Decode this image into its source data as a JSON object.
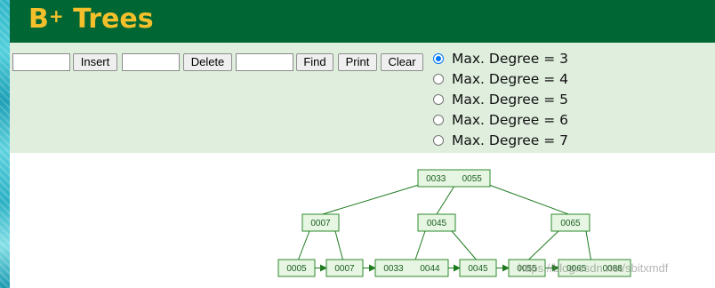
{
  "header": {
    "title_prefix": "B",
    "title_sup": "+",
    "title_rest": " Trees"
  },
  "controls": {
    "insert_value": "",
    "insert_label": "Insert",
    "delete_value": "",
    "delete_label": "Delete",
    "find_value": "",
    "find_label": "Find",
    "print_label": "Print",
    "clear_label": "Clear"
  },
  "degree_options": [
    {
      "label": "Max. Degree = 3",
      "checked": true
    },
    {
      "label": "Max. Degree = 4",
      "checked": false
    },
    {
      "label": "Max. Degree = 5",
      "checked": false
    },
    {
      "label": "Max. Degree = 6",
      "checked": false
    },
    {
      "label": "Max. Degree = 7",
      "checked": false
    }
  ],
  "tree": {
    "root": [
      "0033",
      "0055"
    ],
    "internal": [
      [
        "0007"
      ],
      [
        "0045"
      ],
      [
        "0065"
      ]
    ],
    "leaves": [
      [
        "0005"
      ],
      [
        "0007"
      ],
      [
        "0033",
        "0044"
      ],
      [
        "0045"
      ],
      [
        "0055"
      ],
      [
        "0065",
        "0088"
      ]
    ]
  },
  "watermark": "https://blog.csdn.net/sbitxmdf",
  "colors": {
    "header_bg": "#006633",
    "title": "#f3c02c",
    "panel_bg": "#dfeedd",
    "node_border": "#2e8b2e",
    "node_fill": "#e6f6e2"
  }
}
